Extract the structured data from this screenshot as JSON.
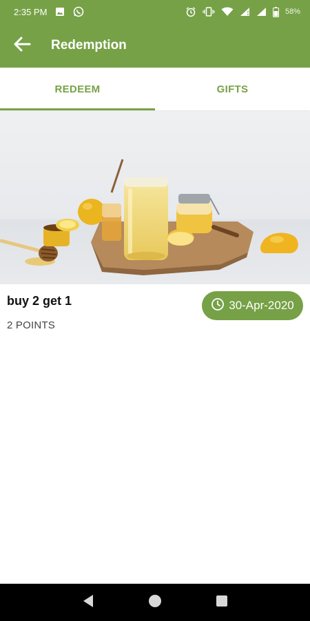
{
  "status_bar": {
    "time": "2:35 PM",
    "battery": "58%",
    "icons": [
      "image-icon",
      "whatsapp-icon",
      "alarm-icon",
      "vibrate-icon",
      "wifi-icon",
      "signal-icon",
      "signal-icon",
      "battery-icon"
    ]
  },
  "app_bar": {
    "title": "Redemption",
    "back_icon": "arrow-left-icon"
  },
  "tabs": [
    {
      "label": "REDEEM",
      "active": true
    },
    {
      "label": "GIFTS",
      "active": false
    }
  ],
  "reward": {
    "title": "buy 2 get 1",
    "points": "2 POINTS",
    "expiry": "30-Apr-2020",
    "expiry_icon": "clock-icon",
    "image_subject": "honey-lemon-drink-photo"
  },
  "nav_bar": {
    "buttons": [
      "back-triangle-icon",
      "home-circle-icon",
      "recents-square-icon"
    ]
  },
  "colors": {
    "brand_green": "#76a147",
    "text_dark": "#111111",
    "text_muted": "#444444"
  }
}
